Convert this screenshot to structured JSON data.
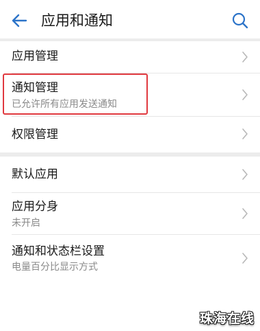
{
  "header": {
    "title": "应用和通知",
    "back_icon": "arrow-left-icon",
    "search_icon": "search-icon",
    "accent": "#2b73c8"
  },
  "rows": [
    {
      "title": "应用管理",
      "subtitle": ""
    },
    {
      "title": "通知管理",
      "subtitle": "已允许所有应用发送通知"
    },
    {
      "title": "权限管理",
      "subtitle": ""
    },
    {
      "title": "默认应用",
      "subtitle": ""
    },
    {
      "title": "应用分身",
      "subtitle": "未开启"
    },
    {
      "title": "通知和状态栏设置",
      "subtitle": "电量百分比显示方式"
    }
  ],
  "highlight_color": "#e0383e",
  "watermark": "珠海在线"
}
